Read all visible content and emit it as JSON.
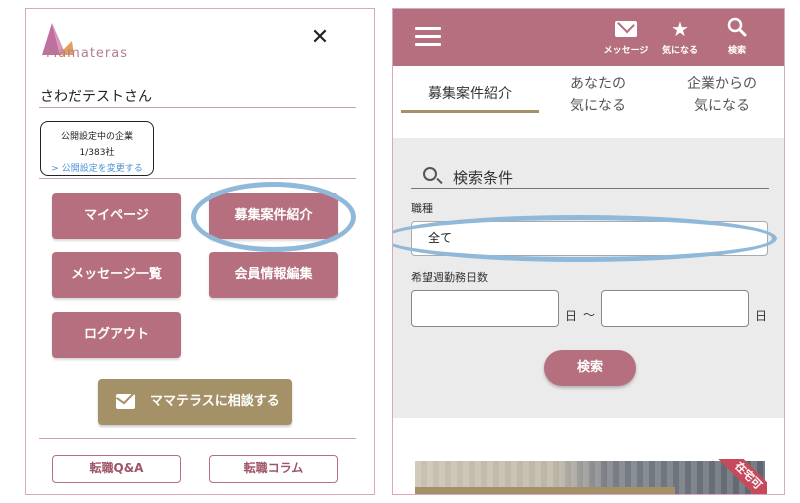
{
  "left_menu": {
    "logo_text": "Mamateras",
    "user_name": "さわだテストさん",
    "public_status": {
      "title": "公開設定中の企業",
      "count": "1/383社",
      "change_link": "> 公開設定を変更する"
    },
    "buttons": {
      "mypage": "マイページ",
      "job_listings": "募集案件紹介",
      "messages": "メッセージ一覧",
      "member_info": "会員情報編集",
      "logout": "ログアウト"
    },
    "consult": "ママテラスに相談する",
    "links": {
      "career_qa": "転職Q&A",
      "career_column": "転職コラム"
    }
  },
  "right_screen": {
    "topbar": {
      "messages": "メッセージ",
      "favorites": "気になる",
      "search": "検索"
    },
    "tabs": [
      {
        "label": "募集案件紹介",
        "active": true
      },
      {
        "label": "あなたの\n気になる",
        "active": false
      },
      {
        "label": "企業からの\n気になる",
        "active": false
      }
    ],
    "search": {
      "title": "検索条件",
      "job_type_label": "職種",
      "job_type_value": "全て",
      "workdays_label": "希望週勤務日数",
      "unit_day": "日",
      "range_sep": "〜",
      "submit": "検索"
    },
    "card": {
      "badge": "在宅可"
    }
  },
  "colors": {
    "brand": "#b56f7e",
    "gold": "#a49167",
    "highlight_oval": "#8fb8d9"
  }
}
